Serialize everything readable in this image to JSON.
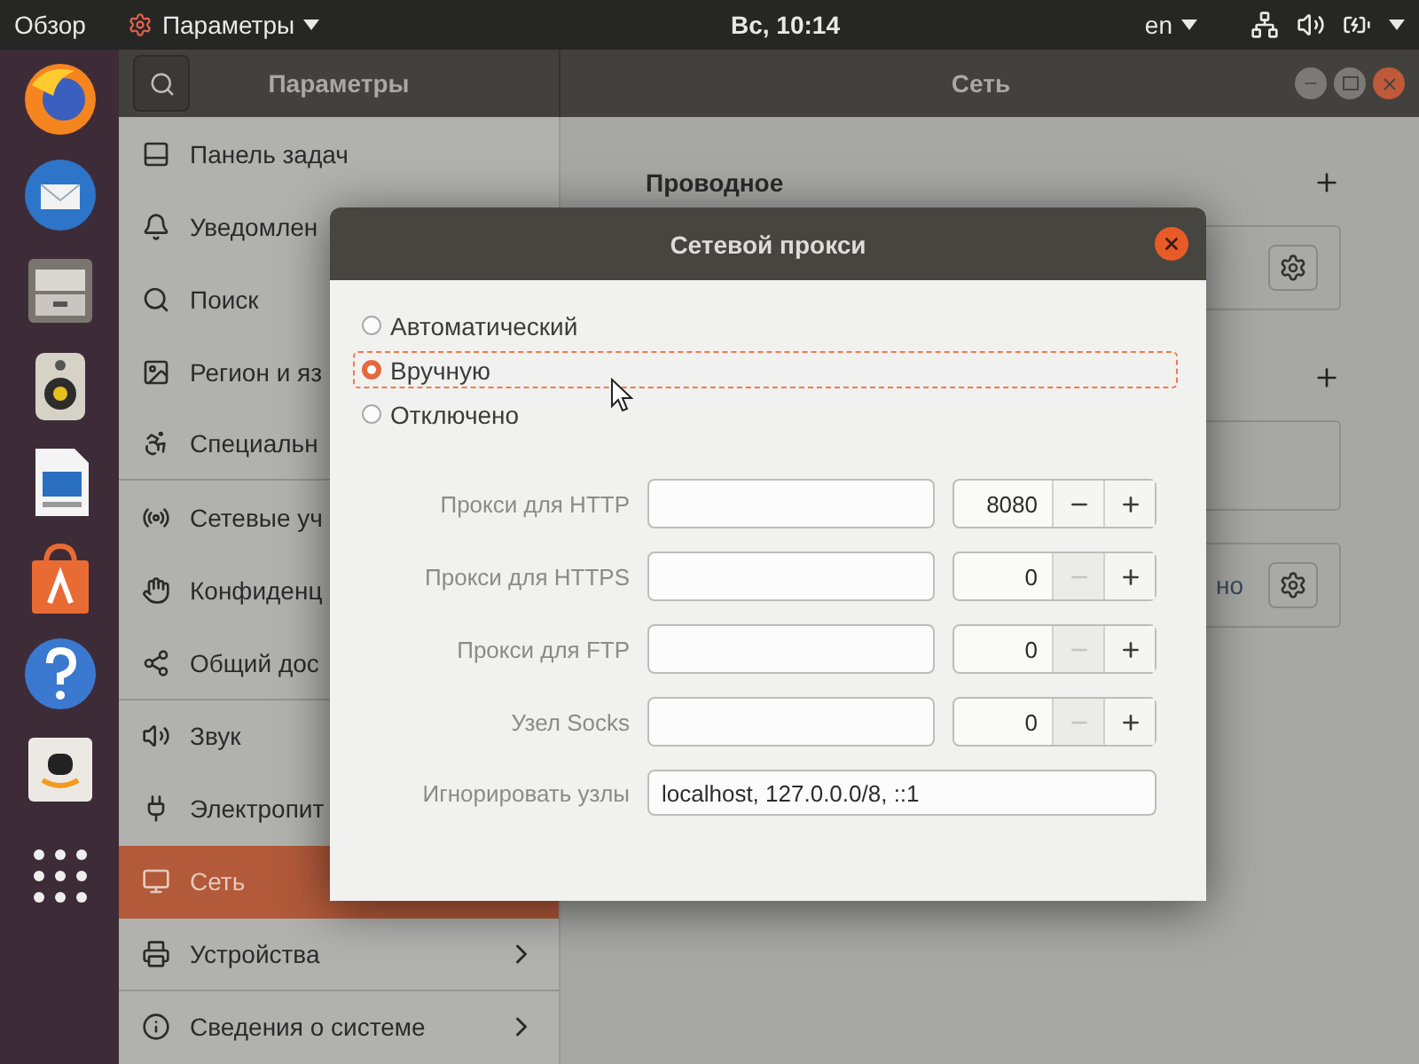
{
  "top_bar": {
    "activities": "Обзор",
    "app_menu": "Параметры",
    "clock": "Вс, 10:14",
    "language": "en"
  },
  "settings": {
    "sidebar_title": "Параметры",
    "content_title": "Сеть",
    "sidebar": [
      {
        "label": "Панель задач",
        "selected": false,
        "submenu": false
      },
      {
        "label": "Уведомлен",
        "selected": false,
        "submenu": false
      },
      {
        "label": "Поиск",
        "selected": false,
        "submenu": false
      },
      {
        "label": "Регион и яз",
        "selected": false,
        "submenu": false
      },
      {
        "label": "Специальн",
        "selected": false,
        "submenu": false
      },
      {
        "label": "Сетевые уч",
        "selected": false,
        "submenu": false
      },
      {
        "label": "Конфиденц",
        "selected": false,
        "submenu": false
      },
      {
        "label": "Общий дос",
        "selected": false,
        "submenu": false
      },
      {
        "label": "Звук",
        "selected": false,
        "submenu": false
      },
      {
        "label": "Электропит",
        "selected": false,
        "submenu": false
      },
      {
        "label": "Сеть",
        "selected": true,
        "submenu": false
      },
      {
        "label": "Устройства",
        "selected": false,
        "submenu": true
      },
      {
        "label": "Сведения о системе",
        "selected": false,
        "submenu": true
      }
    ],
    "content": {
      "heading": "Проводное",
      "card_text": "но"
    }
  },
  "dialog": {
    "title": "Сетевой прокси",
    "modes": [
      {
        "label": "Автоматический",
        "selected": false,
        "focused": false
      },
      {
        "label": "Вручную",
        "selected": true,
        "focused": true
      },
      {
        "label": "Отключено",
        "selected": false,
        "focused": false
      }
    ],
    "rows": [
      {
        "kind": "proxy",
        "label": "Прокси для HTTP",
        "port": "8080",
        "minus_disabled": false
      },
      {
        "kind": "proxy",
        "label": "Прокси для HTTPS",
        "port": "0",
        "minus_disabled": true
      },
      {
        "kind": "proxy",
        "label": "Прокси для FTP",
        "port": "0",
        "minus_disabled": true
      },
      {
        "kind": "proxy",
        "label": "Узел Socks",
        "port": "0",
        "minus_disabled": true
      },
      {
        "kind": "ignore",
        "label": "Игнорировать узлы",
        "value": "localhost, 127.0.0.0/8, ::1"
      }
    ]
  }
}
